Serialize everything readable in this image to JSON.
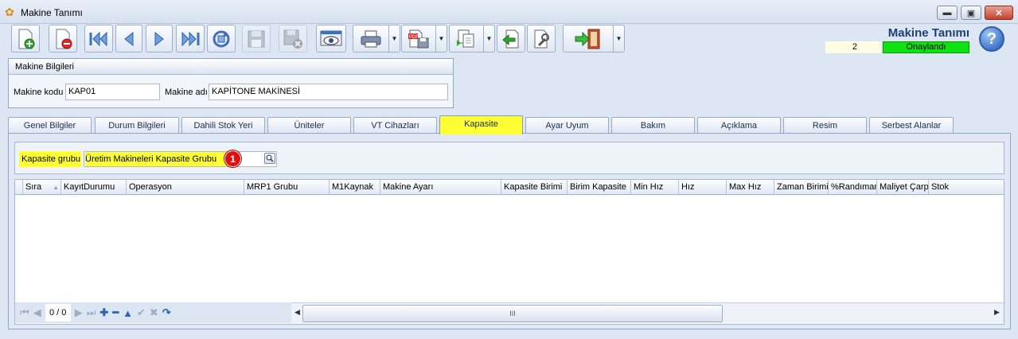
{
  "window": {
    "title": "Makine Tanımı",
    "minimize_label": "▬",
    "maximize_label": "▣",
    "close_label": "✕"
  },
  "header": {
    "form_title": "Makine Tanımı",
    "record_count": "2",
    "status": "Onaylandı",
    "help_label": "?"
  },
  "toolbar": {
    "icons": [
      "new-document-icon",
      "delete-document-icon",
      "first-record-icon",
      "previous-record-icon",
      "next-record-icon",
      "last-record-icon",
      "refresh-icon",
      "save-icon",
      "save-close-icon",
      "preview-icon",
      "print-icon",
      "pdf-export-icon",
      "copy-icon",
      "back-icon",
      "tools-icon",
      "exit-icon"
    ]
  },
  "machine_info": {
    "group_title": "Makine Bilgileri",
    "code_label": "Makine kodu",
    "code_value": "KAP01",
    "name_label": "Makine adı",
    "name_value": "KAPİTONE MAKİNESİ"
  },
  "tabs": [
    "Genel Bilgiler",
    "Durum Bilgileri",
    "Dahili Stok Yeri",
    "Üniteler",
    "VT Cihazları",
    "Kapasite",
    "Ayar Uyum",
    "Bakım",
    "Açıklama",
    "Resim",
    "Serbest Alanlar"
  ],
  "active_tab": "Kapasite",
  "capacity": {
    "group_label": "Kapasite grubu",
    "group_value": "Üretim Makineleri Kapasite Grubu",
    "badge": "1"
  },
  "grid": {
    "columns": [
      "Sıra",
      "KayıtDurumu",
      "Operasyon",
      "MRP1 Grubu",
      "M1Kaynak",
      "Makine Ayarı",
      "Kapasite Birimi",
      "Birim Kapasite",
      "Min Hız",
      "Hız",
      "Max Hız",
      "Zaman Birimi",
      "%Randıman",
      "Maliyet Çarp",
      "Stok"
    ],
    "rows": [],
    "pager": "0 / 0",
    "scroll_thumb_label": "III"
  },
  "colors": {
    "highlight": "#ffff33",
    "status_green": "#10e110",
    "title_blue": "#1f3f7a",
    "badge_red": "#e01010"
  }
}
